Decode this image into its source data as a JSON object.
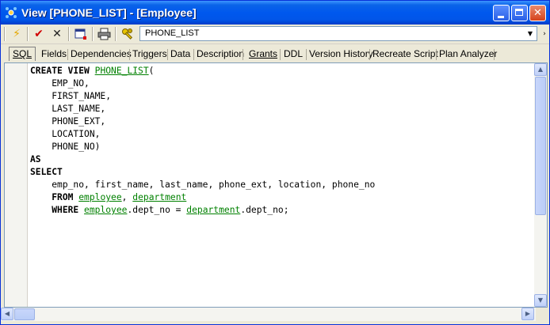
{
  "window": {
    "title": "View [PHONE_LIST] - [Employee]",
    "minimize_icon": "minimize-icon",
    "maximize_icon": "maximize-icon",
    "close_icon": "close-icon"
  },
  "toolbar": {
    "tools": [
      "lightning-icon",
      "checkmark-icon",
      "cross-icon",
      "calendar-icon",
      "printer-icon",
      "keys-icon"
    ],
    "object_selector_value": "PHONE_LIST"
  },
  "tabs": [
    "SQL",
    "Fields",
    "Dependencies",
    "Triggers",
    "Data",
    "Description",
    "Grants",
    "DDL",
    "Version History",
    "Recreate Script",
    "Plan Analyzer"
  ],
  "active_tab": "SQL",
  "sql": {
    "line1_kw": "CREATE VIEW",
    "line1_obj": "PHONE_LIST",
    "line1_paren": "(",
    "fields": [
      "EMP_NO,",
      "FIRST_NAME,",
      "LAST_NAME,",
      "PHONE_EXT,",
      "LOCATION,",
      "PHONE_NO)"
    ],
    "as_kw": "AS",
    "select_kw": "SELECT",
    "select_cols": "emp_no, first_name, last_name, phone_ext, location, phone_no",
    "from_kw": "FROM",
    "from_obj1": "employee",
    "from_comma": ",",
    "from_obj2": "department",
    "where_kw": "WHERE",
    "where_obj1": "employee",
    "where_mid": ".dept_no = ",
    "where_obj2": "department",
    "where_end": ".dept_no;"
  },
  "colors": {
    "titlebar": "#0058ee",
    "object_link": "#008000"
  }
}
